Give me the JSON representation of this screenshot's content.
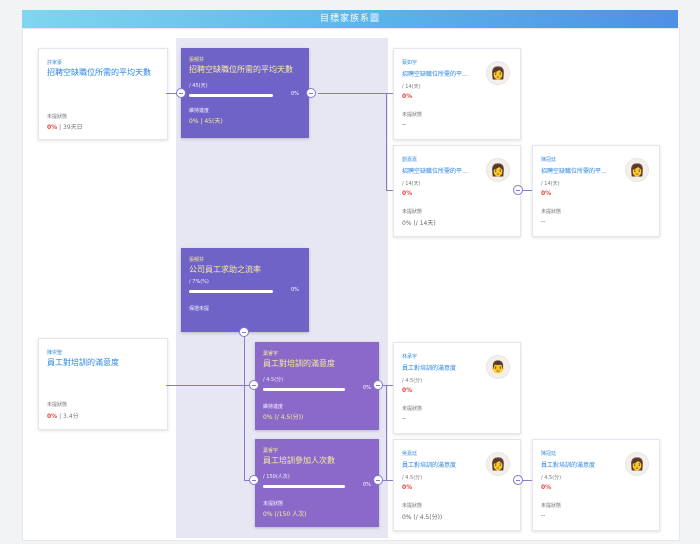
{
  "header": {
    "title": "目標家族系圖"
  },
  "left_cards": [
    {
      "owner": "許家豪",
      "title": "招聘空缺職位所需的平均天數",
      "status_label": "未提狀態",
      "pct": "0%",
      "meta": " | 39天日"
    },
    {
      "owner": "陳崇聖",
      "title": "員工對培訓的滿意度",
      "status_label": "未提狀態",
      "pct": "0%",
      "meta": " | 3.4分"
    }
  ],
  "center_top": {
    "owner": "張郁芬",
    "title": "招聘空缺職位所需的平均天數",
    "sub": "/ 45(天)",
    "bar_pct": "0%",
    "label": "維持進度",
    "meta": "0% | 45(天)"
  },
  "center_mid": {
    "owner": "張郁芬",
    "title": "公司員工求助之流率",
    "sub": "/ 7%(%)",
    "bar_pct": "0%",
    "label": "保證未提"
  },
  "center_bottom1": {
    "owner": "葉睿宇",
    "title": "員工對培訓的滿意度",
    "sub": "/ 4.5(分)",
    "bar_pct": "0%",
    "label": "維持進度",
    "meta": "0% (/ 4.5(分))"
  },
  "center_bottom2": {
    "owner": "葉睿宇",
    "title": "員工培訓參加人次數",
    "sub": "/ 150(人次)",
    "bar_pct": "0%",
    "label": "未提狀態",
    "meta": "0% (/150 人次)"
  },
  "right_cards": [
    {
      "owner": "蔡如宇",
      "title": "招聘空缺職位所需的平...",
      "sub": "/ 14(天)",
      "pct": "0%",
      "label": "未提狀態",
      "meta": "--"
    },
    {
      "owner": "劉嘉嘉",
      "title": "招聘空缺職位所需的平...",
      "sub": "/ 14(天)",
      "pct": "0%",
      "label": "未提狀態",
      "meta": "0% (/ 14天)"
    },
    {
      "owner": "陳冠廷",
      "title": "招聘空缺職位所需的平...",
      "sub": "/ 14(天)",
      "pct": "0%",
      "label": "未提狀態",
      "meta": "--"
    },
    {
      "owner": "林承宇",
      "title": "員工對培訓的滿意度",
      "sub": "/ 4.5(分)",
      "pct": "0%",
      "label": "未提狀態",
      "meta": "--"
    },
    {
      "owner": "吳嘉廷",
      "title": "員工對培訓的滿意度",
      "sub": "/ 4.5(分)",
      "pct": "0%",
      "label": "未提狀態",
      "meta": "0% (/ 4.5(分))"
    },
    {
      "owner": "陳冠廷",
      "title": "員工對培訓的滿意度",
      "sub": "/ 4.5(分)",
      "pct": "0%",
      "label": "未提狀態",
      "meta": "--"
    }
  ]
}
